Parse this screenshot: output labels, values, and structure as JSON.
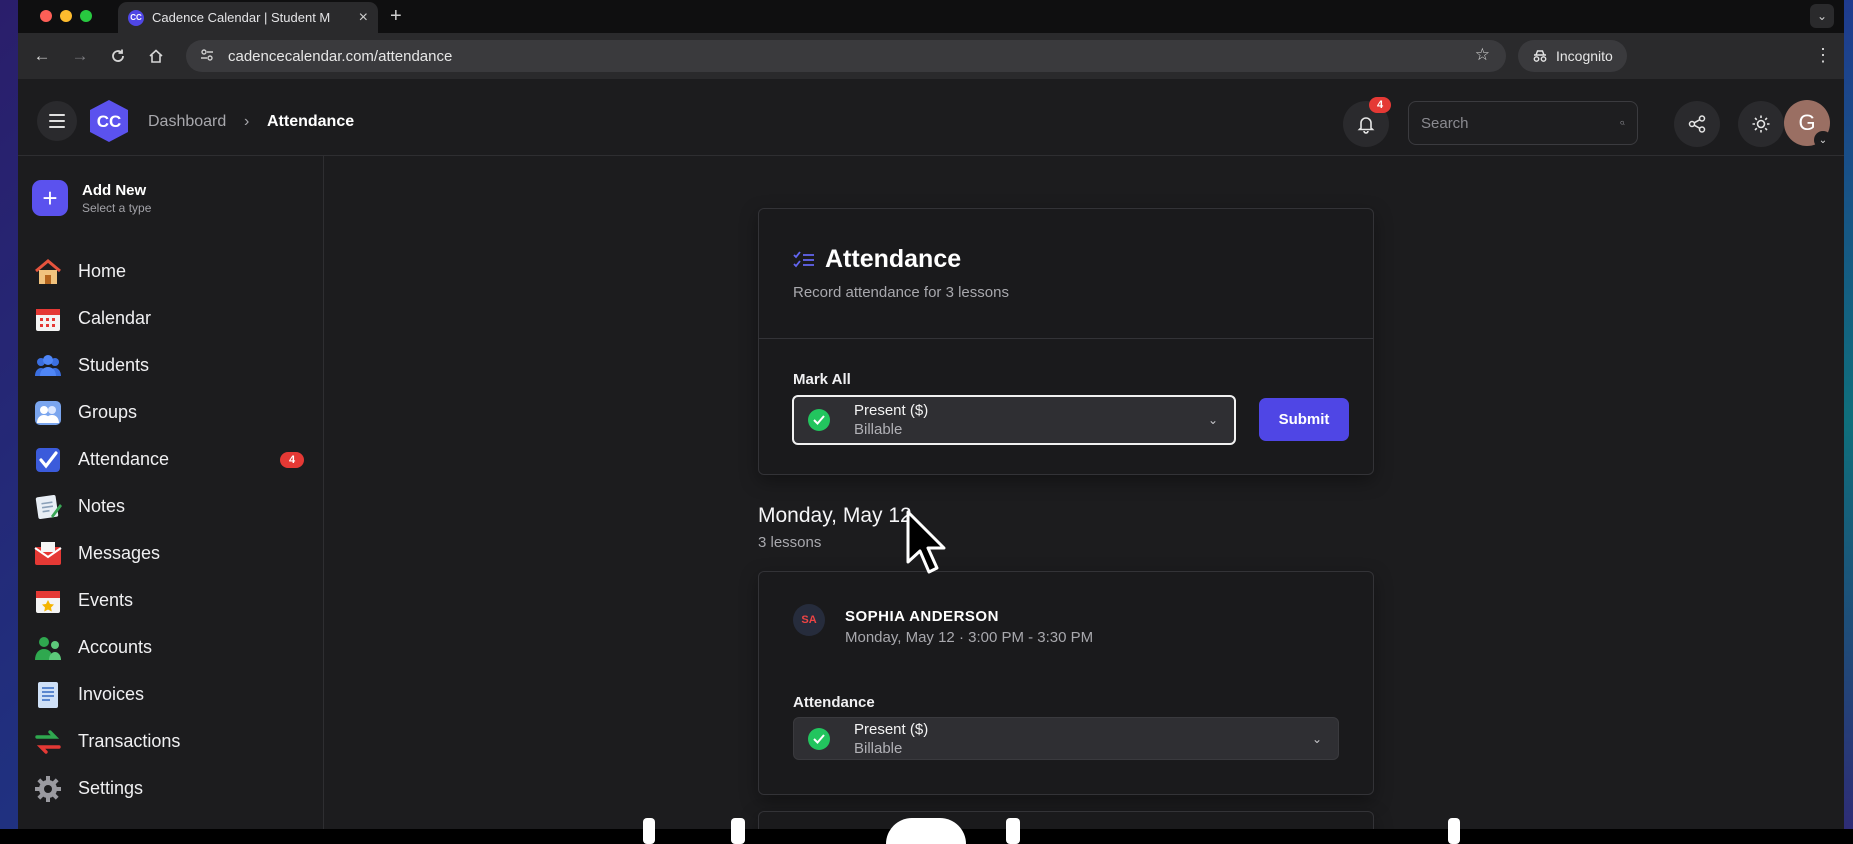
{
  "browser": {
    "tab_title": "Cadence Calendar | Student M",
    "tab_favicon": "CC",
    "url": "cadencecalendar.com/attendance",
    "incognito_label": "Incognito"
  },
  "header": {
    "breadcrumb_parent": "Dashboard",
    "breadcrumb_separator": "›",
    "breadcrumb_current": "Attendance",
    "logo_text": "CC",
    "notification_count": "4",
    "search_placeholder": "Search",
    "avatar_initial": "G"
  },
  "sidebar": {
    "add_new_title": "Add New",
    "add_new_sub": "Select a type",
    "items": [
      {
        "label": "Home",
        "icon": "house-icon"
      },
      {
        "label": "Calendar",
        "icon": "calendar-icon"
      },
      {
        "label": "Students",
        "icon": "students-icon"
      },
      {
        "label": "Groups",
        "icon": "groups-icon"
      },
      {
        "label": "Attendance",
        "icon": "checkbox-icon",
        "badge": "4"
      },
      {
        "label": "Notes",
        "icon": "notes-icon"
      },
      {
        "label": "Messages",
        "icon": "envelope-icon"
      },
      {
        "label": "Events",
        "icon": "event-calendar-icon"
      },
      {
        "label": "Accounts",
        "icon": "accounts-icon"
      },
      {
        "label": "Invoices",
        "icon": "invoice-icon"
      },
      {
        "label": "Transactions",
        "icon": "transfer-arrows-icon"
      },
      {
        "label": "Settings",
        "icon": "gear-icon"
      }
    ]
  },
  "attendance_card": {
    "title": "Attendance",
    "subtitle": "Record attendance for 3 lessons",
    "mark_all_label": "Mark All",
    "mark_all_value": "Present ($)",
    "mark_all_sub": "Billable",
    "submit_label": "Submit"
  },
  "day": {
    "title": "Monday, May 12",
    "lesson_count": "3 lessons"
  },
  "lesson": {
    "initials": "SA",
    "student_name": "SOPHIA ANDERSON",
    "time": "Monday, May 12 · 3:00 PM - 3:30 PM",
    "attendance_label": "Attendance",
    "status_value": "Present ($)",
    "status_sub": "Billable"
  },
  "colors": {
    "accent": "#4f46e5",
    "present_green": "#22c55e",
    "badge_red": "#e53935"
  }
}
